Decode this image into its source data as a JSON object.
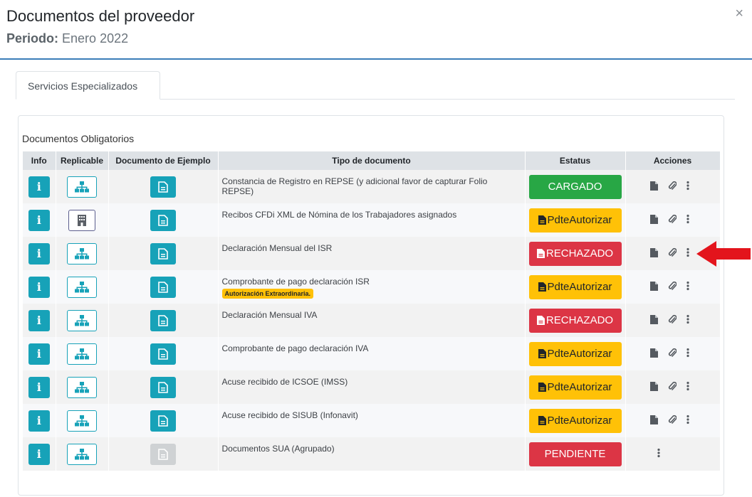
{
  "modal": {
    "title": "Documentos del proveedor",
    "period_label": "Periodo:",
    "period_value": "Enero 2022",
    "close": "×"
  },
  "tabs": [
    {
      "label": "Servicios Especializados"
    }
  ],
  "section_title": "Documentos Obligatorios",
  "table": {
    "headers": [
      "Info",
      "Replicable",
      "Documento de Ejemplo",
      "Tipo de documento",
      "Estatus",
      "Acciones"
    ],
    "rows": [
      {
        "tipo": "Constancia de Registro en REPSE (y adicional favor de capturar Folio REPSE)",
        "estatus": "CARGADO",
        "replicable_icon": "sitemap-icon",
        "example_enabled": true
      },
      {
        "tipo": "Recibos CFDi XML de Nómina de los Trabajadores asignados",
        "estatus": "PdteAutorizar",
        "replicable_icon": "building-icon",
        "example_enabled": true
      },
      {
        "tipo": "Declaración Mensual del ISR",
        "estatus": "RECHAZADO",
        "replicable_icon": "sitemap-icon",
        "example_enabled": true
      },
      {
        "tipo": "Comprobante de pago declaración ISR",
        "badge": "Autorización Extraordinaria.",
        "estatus": "PdteAutorizar",
        "replicable_icon": "sitemap-icon",
        "example_enabled": true
      },
      {
        "tipo": "Declaración Mensual IVA",
        "estatus": "RECHAZADO",
        "replicable_icon": "sitemap-icon",
        "example_enabled": true
      },
      {
        "tipo": "Comprobante de pago declaración IVA",
        "estatus": "PdteAutorizar",
        "replicable_icon": "sitemap-icon",
        "example_enabled": true
      },
      {
        "tipo": "Acuse recibido de ICSOE (IMSS)",
        "estatus": "PdteAutorizar",
        "replicable_icon": "sitemap-icon",
        "example_enabled": true
      },
      {
        "tipo": "Acuse recibido de SISUB (Infonavit)",
        "estatus": "PdteAutorizar",
        "replicable_icon": "sitemap-icon",
        "example_enabled": true
      },
      {
        "tipo": "Documentos SUA (Agrupado)",
        "estatus": "PENDIENTE",
        "replicable_icon": "sitemap-icon",
        "example_enabled": false
      }
    ]
  },
  "colors": {
    "info": "#17a2b8",
    "cargado": "#28a745",
    "pdte": "#ffc107",
    "rechazado": "#dc3545",
    "header_rule": "#3b7db8",
    "arrow": "#e3141c"
  },
  "icons": {
    "info": "i",
    "file": "file-icon",
    "attach": "paperclip-icon",
    "more": "ellipsis-vertical-icon",
    "arrow": "red-arrow-icon"
  }
}
